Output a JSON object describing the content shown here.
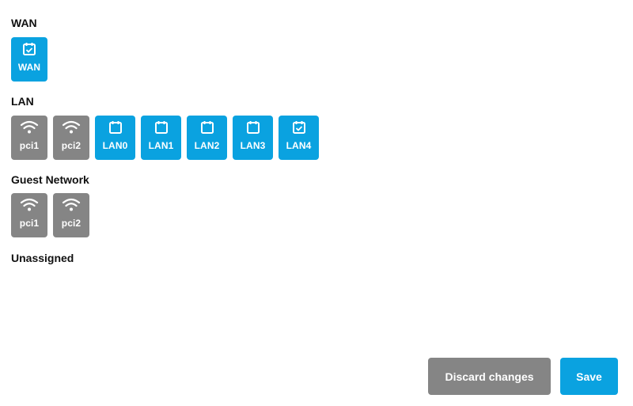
{
  "sections": [
    {
      "title": "WAN",
      "items": [
        {
          "label": "WAN",
          "type": "ethernet",
          "icon": "calendar-check-icon",
          "color": "#0aa2e0"
        }
      ]
    },
    {
      "title": "LAN",
      "items": [
        {
          "label": "pci1",
          "type": "wireless",
          "icon": "wifi-icon",
          "color": "#858585"
        },
        {
          "label": "pci2",
          "type": "wireless",
          "icon": "wifi-icon",
          "color": "#858585"
        },
        {
          "label": "LAN0",
          "type": "ethernet",
          "icon": "calendar-icon",
          "color": "#0aa2e0"
        },
        {
          "label": "LAN1",
          "type": "ethernet",
          "icon": "calendar-icon",
          "color": "#0aa2e0"
        },
        {
          "label": "LAN2",
          "type": "ethernet",
          "icon": "calendar-icon",
          "color": "#0aa2e0"
        },
        {
          "label": "LAN3",
          "type": "ethernet",
          "icon": "calendar-icon",
          "color": "#0aa2e0"
        },
        {
          "label": "LAN4",
          "type": "ethernet",
          "icon": "calendar-check-icon",
          "color": "#0aa2e0"
        }
      ]
    },
    {
      "title": "Guest Network",
      "items": [
        {
          "label": "pci1",
          "type": "wireless",
          "icon": "wifi-icon",
          "color": "#858585"
        },
        {
          "label": "pci2",
          "type": "wireless",
          "icon": "wifi-icon",
          "color": "#858585"
        }
      ]
    },
    {
      "title": "Unassigned",
      "items": []
    }
  ],
  "actions": {
    "discard_label": "Discard changes",
    "save_label": "Save"
  },
  "colors": {
    "accent": "#0aa2e0",
    "inactive": "#858585"
  }
}
